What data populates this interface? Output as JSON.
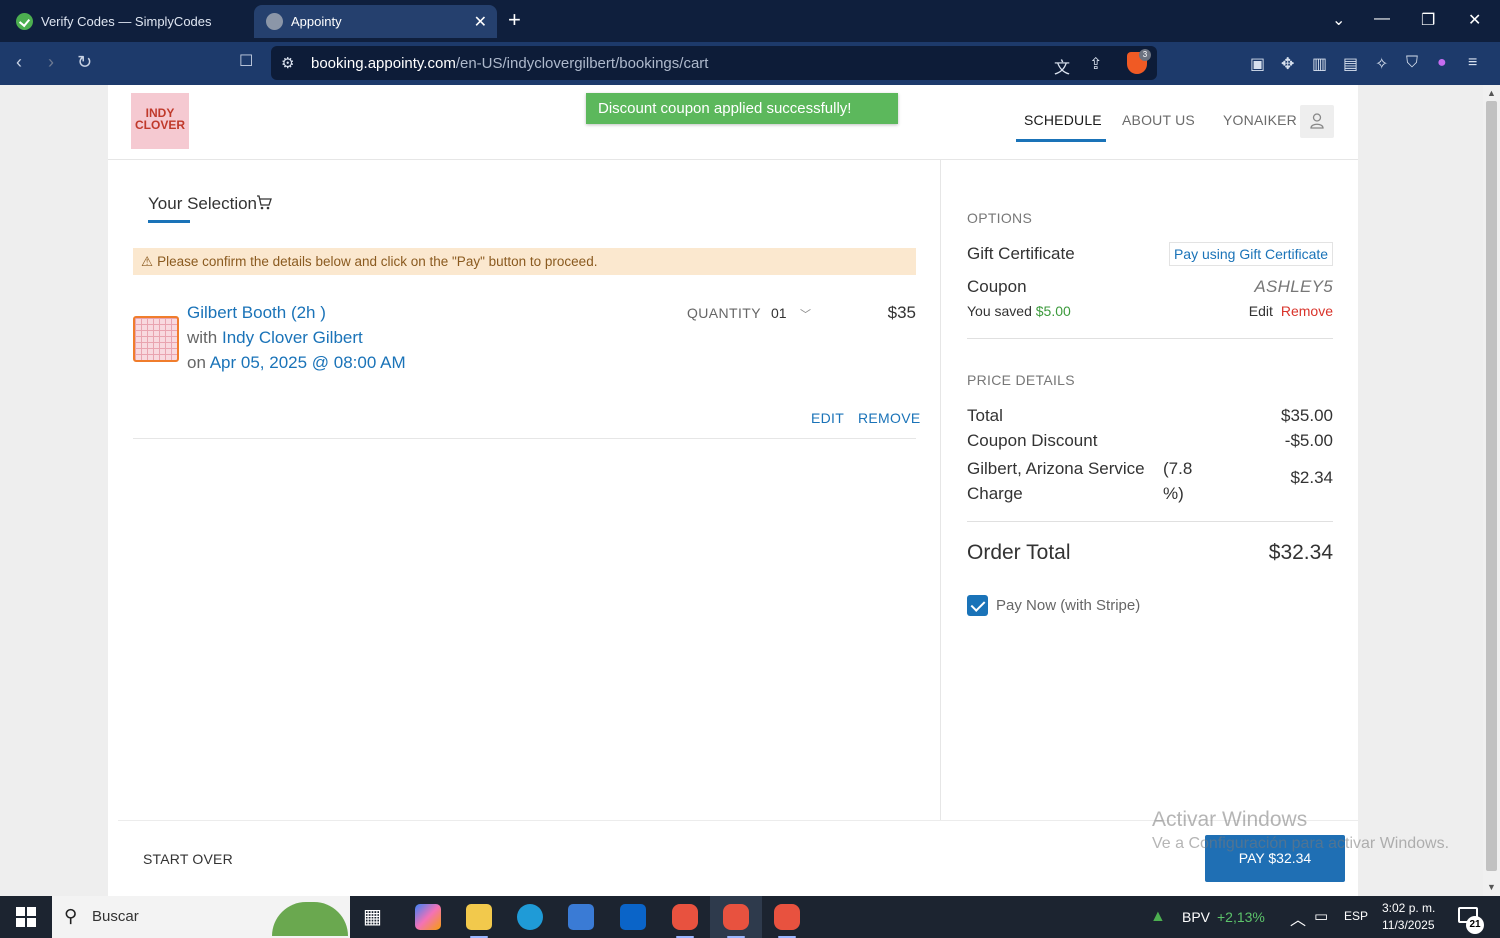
{
  "browser": {
    "tabs": [
      {
        "title": "Verify Codes — SimplyCodes",
        "active": false
      },
      {
        "title": "Appointy",
        "active": true
      }
    ],
    "url_host": "booking.appointy.com",
    "url_path": "/en-US/indyclovergilbert/bookings/cart",
    "shield_count": "3"
  },
  "header": {
    "logo_lines": [
      "INDY",
      "CLOVER"
    ],
    "toast": "Discount coupon applied successfully!",
    "nav": {
      "schedule": "SCHEDULE",
      "about": "ABOUT US",
      "user": "YONAIKER"
    }
  },
  "selection": {
    "title": "Your Selection",
    "warning": "Please confirm the details below and click on the \"Pay\" button to proceed.",
    "item": {
      "name": "Gilbert Booth (2h )",
      "with_prefix": "with",
      "provider": "Indy Clover Gilbert",
      "on_prefix": "on",
      "datetime": "Apr 05, 2025 @ 08:00 AM",
      "quantity_label": "QUANTITY",
      "quantity": "01",
      "price": "$35",
      "edit": "EDIT",
      "remove": "REMOVE"
    }
  },
  "options": {
    "heading": "OPTIONS",
    "gift_label": "Gift Certificate",
    "gift_button": "Pay using Gift Certificate",
    "coupon_label": "Coupon",
    "coupon_code": "ASHLEY5",
    "saved_prefix": "You saved",
    "saved_amount": "$5.00",
    "coupon_edit": "Edit",
    "coupon_remove": "Remove"
  },
  "price_details": {
    "heading": "PRICE DETAILS",
    "total_label": "Total",
    "total_value": "$35.00",
    "discount_label": "Coupon Discount",
    "discount_value": "-$5.00",
    "tax_label": "Gilbert, Arizona Service Charge",
    "tax_rate": "(7.8 %)",
    "tax_value": "$2.34",
    "order_total_label": "Order Total",
    "order_total_value": "$32.34",
    "pay_now_label": "Pay Now (with Stripe)",
    "pay_now_checked": true
  },
  "footer": {
    "start_over": "START OVER",
    "pay_button": "PAY $32.34"
  },
  "watermark": {
    "line1": "Activar Windows",
    "line2": "Ve a Configuración para activar Windows."
  },
  "taskbar": {
    "search_placeholder": "Buscar",
    "stock_name": "BPV",
    "stock_change": "+2,13%",
    "language": "ESP",
    "time": "3:02 p. m.",
    "date": "11/3/2025",
    "notifications": "21"
  },
  "colors": {
    "brand_blue": "#1a73b8",
    "toast_green": "#5cb85c",
    "warning_bg": "#fbe8cf",
    "remove_red": "#d9342b",
    "saved_green": "#3c9a3c"
  }
}
